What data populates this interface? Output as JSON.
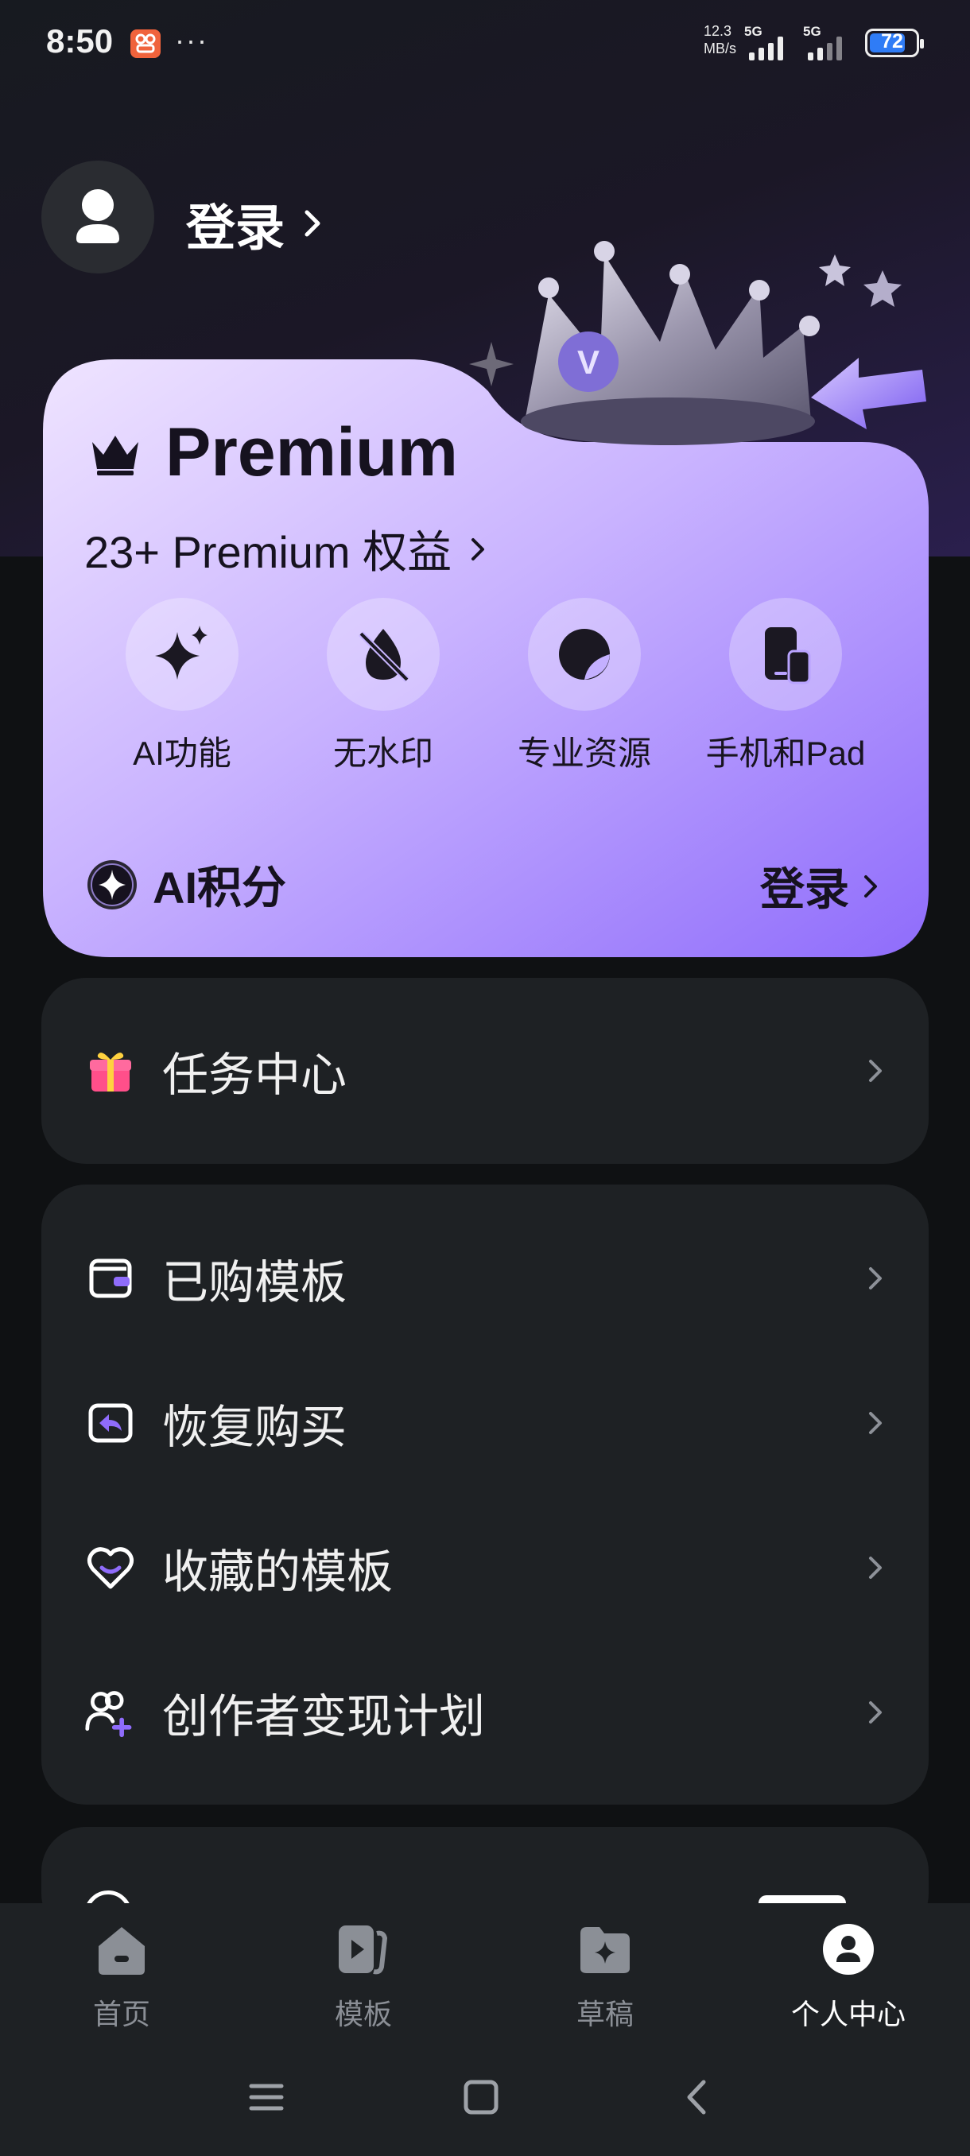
{
  "status_bar": {
    "time": "8:50",
    "more": "···",
    "net_speed_value": "12.3",
    "net_speed_unit": "MB/s",
    "sim1": "5G",
    "sim2": "5G",
    "battery": "72"
  },
  "header": {
    "login_label": "登录"
  },
  "premium": {
    "title": "Premium",
    "subtitle": "23+ Premium 权益",
    "benefits": [
      {
        "label": "AI功能",
        "icon": "sparkle-icon"
      },
      {
        "label": "无水印",
        "icon": "no-watermark-icon"
      },
      {
        "label": "专业资源",
        "icon": "pro-resource-icon"
      },
      {
        "label": "手机和Pad",
        "icon": "phone-pad-icon"
      }
    ],
    "ai_points_label": "AI积分",
    "ai_login_label": "登录"
  },
  "tasks": {
    "label": "任务中心"
  },
  "menu": [
    {
      "label": "已购模板",
      "icon": "purchased-template-icon"
    },
    {
      "label": "恢复购买",
      "icon": "restore-purchase-icon"
    },
    {
      "label": "收藏的模板",
      "icon": "favorite-heart-icon"
    },
    {
      "label": "创作者变现计划",
      "icon": "creator-plan-icon"
    }
  ],
  "bottom_nav": [
    {
      "label": "首页",
      "icon": "home-icon"
    },
    {
      "label": "模板",
      "icon": "template-icon"
    },
    {
      "label": "草稿",
      "icon": "draft-folder-icon"
    },
    {
      "label": "个人中心",
      "icon": "profile-icon",
      "active": true
    }
  ],
  "colors": {
    "accent_purple": "#8f6cfb",
    "card_gradient_start": "#efe4ff",
    "card_gradient_end": "#9277fb",
    "surface": "#1e2124",
    "background": "#0f1113"
  }
}
